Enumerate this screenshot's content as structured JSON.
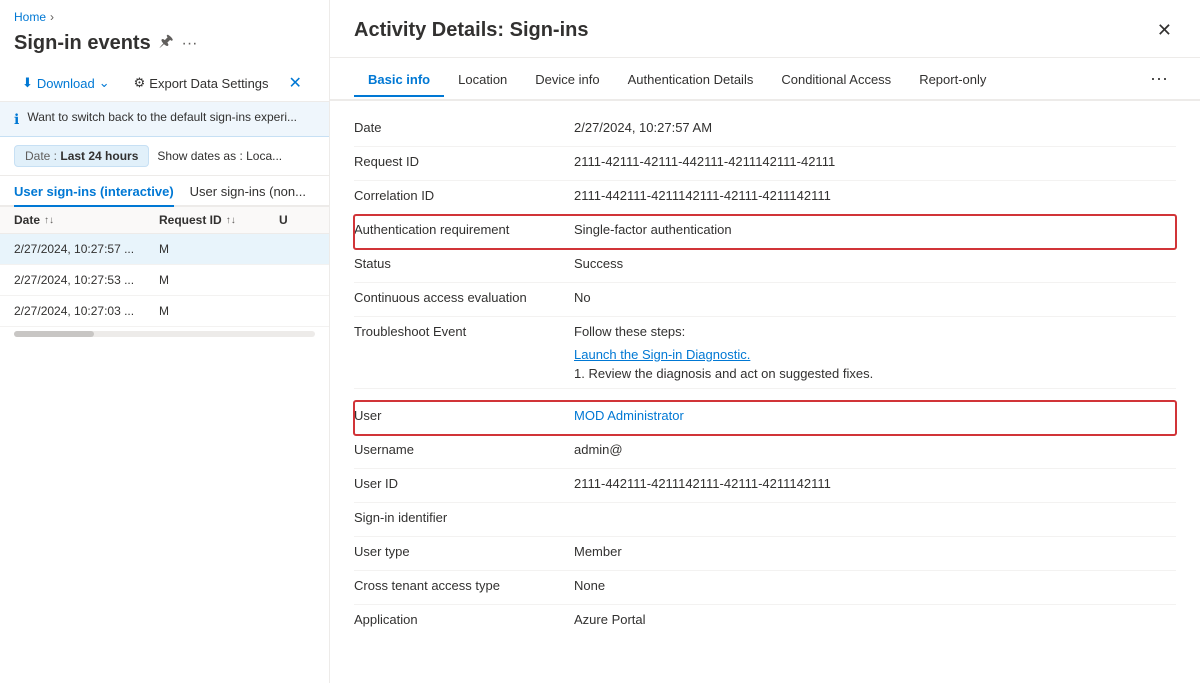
{
  "left": {
    "breadcrumb_home": "Home",
    "page_title": "Sign-in events",
    "toolbar": {
      "download_label": "Download",
      "export_label": "Export Data Settings"
    },
    "info_banner": "Want to switch back to the default sign-ins experi...",
    "filter": {
      "label": "Date : ",
      "value": "Last 24 hours",
      "show_dates": "Show dates as : Loca..."
    },
    "tabs": [
      {
        "id": "interactive",
        "label": "User sign-ins (interactive)",
        "active": true
      },
      {
        "id": "noninteractive",
        "label": "User sign-ins (non...",
        "active": false
      }
    ],
    "table_headers": {
      "date": "Date",
      "request_id": "Request ID",
      "u": "U"
    },
    "rows": [
      {
        "date": "2/27/2024, 10:27:57 ...",
        "request_id": "M",
        "u": ""
      },
      {
        "date": "2/27/2024, 10:27:53 ...",
        "request_id": "M",
        "u": ""
      },
      {
        "date": "2/27/2024, 10:27:03 ...",
        "request_id": "M",
        "u": ""
      }
    ]
  },
  "right": {
    "panel_title": "Activity Details: Sign-ins",
    "tabs": [
      {
        "id": "basic",
        "label": "Basic info",
        "active": true
      },
      {
        "id": "location",
        "label": "Location",
        "active": false
      },
      {
        "id": "device",
        "label": "Device info",
        "active": false
      },
      {
        "id": "auth",
        "label": "Authentication Details",
        "active": false
      },
      {
        "id": "conditional",
        "label": "Conditional Access",
        "active": false
      },
      {
        "id": "report",
        "label": "Report-only",
        "active": false
      }
    ],
    "fields": [
      {
        "id": "date",
        "label": "Date",
        "value": "2/27/2024, 10:27:57 AM",
        "highlight": false,
        "type": "text"
      },
      {
        "id": "request_id",
        "label": "Request ID",
        "value": "2111-42111-42111-442111-4211142111-42111",
        "highlight": false,
        "type": "text"
      },
      {
        "id": "correlation_id",
        "label": "Correlation ID",
        "value": "2111-442111-4211142111-42111-4211142111",
        "highlight": false,
        "type": "text"
      },
      {
        "id": "auth_requirement",
        "label": "Authentication requirement",
        "value": "Single-factor authentication",
        "highlight": true,
        "type": "text"
      },
      {
        "id": "status",
        "label": "Status",
        "value": "Success",
        "highlight": false,
        "type": "text"
      },
      {
        "id": "continuous_access",
        "label": "Continuous access evaluation",
        "value": "No",
        "highlight": false,
        "type": "text"
      },
      {
        "id": "troubleshoot",
        "label": "Troubleshoot Event",
        "highlight": false,
        "type": "troubleshoot",
        "follow": "Follow these steps:",
        "link": "Launch the Sign-in Diagnostic.",
        "step": "1. Review the diagnosis and act on suggested fixes."
      },
      {
        "id": "user",
        "label": "User",
        "value": "MOD Administrator",
        "highlight": true,
        "type": "link"
      },
      {
        "id": "username",
        "label": "Username",
        "value": "admin@",
        "highlight": false,
        "type": "text"
      },
      {
        "id": "user_id",
        "label": "User ID",
        "value": "2111-442111-4211142111-42111-4211142111",
        "highlight": false,
        "type": "text"
      },
      {
        "id": "signin_identifier",
        "label": "Sign-in identifier",
        "value": "",
        "highlight": false,
        "type": "text"
      },
      {
        "id": "user_type",
        "label": "User type",
        "value": "Member",
        "highlight": false,
        "type": "text"
      },
      {
        "id": "cross_tenant",
        "label": "Cross tenant access type",
        "value": "None",
        "highlight": false,
        "type": "text"
      },
      {
        "id": "application",
        "label": "Application",
        "value": "Azure Portal",
        "highlight": false,
        "type": "text"
      }
    ]
  },
  "icons": {
    "chevron_right": "›",
    "sort_updown": "↑↓",
    "pin": "📌",
    "more": "···",
    "close": "✕",
    "download": "⬇",
    "chevron_down": "⌄",
    "info": "ℹ",
    "gear": "⚙"
  }
}
